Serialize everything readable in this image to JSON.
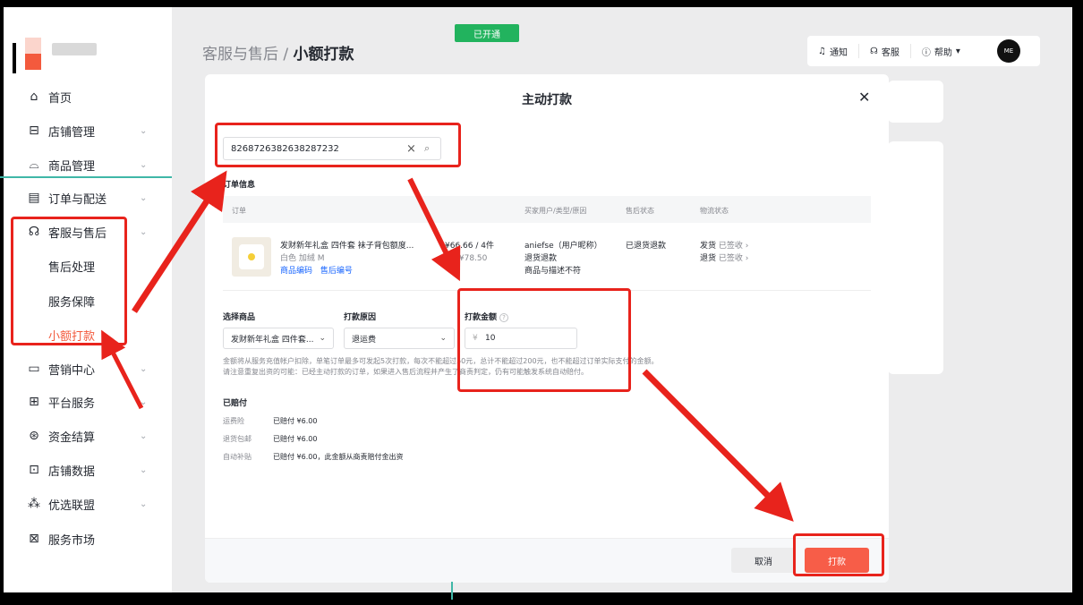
{
  "sidebar": {
    "items": [
      {
        "label": "首页",
        "icon": "home-icon",
        "glyph": "⌂",
        "chevron": false
      },
      {
        "label": "店铺管理",
        "icon": "store-icon",
        "glyph": "⊟",
        "chevron": true
      },
      {
        "label": "商品管理",
        "icon": "bag-icon",
        "glyph": "⌓",
        "chevron": true
      },
      {
        "label": "订单与配送",
        "icon": "order-icon",
        "glyph": "▤",
        "chevron": true
      },
      {
        "label": "客服与售后",
        "icon": "headset-icon",
        "glyph": "☊",
        "chevron": true
      },
      {
        "label": "营销中心",
        "icon": "marketing-icon",
        "glyph": "▭",
        "chevron": true
      },
      {
        "label": "平台服务",
        "icon": "briefcase-icon",
        "glyph": "⊞",
        "chevron": true
      },
      {
        "label": "资金结算",
        "icon": "yuan-icon",
        "glyph": "⊛",
        "chevron": true
      },
      {
        "label": "店铺数据",
        "icon": "chart-icon",
        "glyph": "⊡",
        "chevron": true
      },
      {
        "label": "优选联盟",
        "icon": "alliance-icon",
        "glyph": "⁂",
        "chevron": true
      },
      {
        "label": "服务市场",
        "icon": "market-icon",
        "glyph": "⊠",
        "chevron": false
      }
    ],
    "subitems": [
      "售后处理",
      "服务保障",
      "小额打款"
    ],
    "active_subitem": "小额打款"
  },
  "header": {
    "breadcrumb_parent": "客服与售后",
    "breadcrumb_sep": " / ",
    "breadcrumb_current": "小额打款",
    "badge": "已开通",
    "notify": "通知",
    "service": "客服",
    "help": "帮助",
    "avatar_text": "ME"
  },
  "modal": {
    "title": "主动打款",
    "close_glyph": "✕",
    "search_value": "8268726382638287232",
    "order_info_label": "订单信息",
    "columns": [
      "订单",
      "买家用户/类型/原因",
      "售后状态",
      "物流状态"
    ],
    "order": {
      "product_name": "发财新年礼盒 四件套 袜子背包额度...",
      "spec": "白色 加绒 M",
      "product_code": "商品编码",
      "aftersale_code": "售后编号",
      "price_qty": "¥66.66 / 4件",
      "paid": "款 ¥78.50",
      "buyer": "aniefse（用户昵称）",
      "type": "退货退款",
      "reason": "商品与描述不符",
      "aftersale_status": "已退货退款",
      "ship_label": "发货",
      "ship_status": "已签收 ›",
      "return_label": "退货",
      "return_status": "已签收 ›"
    },
    "select_product_label": "选择商品",
    "select_product_value": "发财新年礼盒 四件套...",
    "reason_label": "打款原因",
    "reason_value": "退运费",
    "amount_label": "打款金额",
    "amount_currency": "¥",
    "amount_value": "10",
    "note_1": "金额将从服务充值帐户扣除，单笔订单最多可发起5次打款，每次不能超过50元，总计不能超过200元，也不能超过订单实际支付的金额。",
    "note_2": "请注意重复出资的可能：已经主动打款的订单，如果进入售后流程并产生了商责判定，仍有可能触发系统自动赔付。",
    "paid_label": "已赔付",
    "paid_rows": [
      {
        "k": "运费险",
        "v": "已赔付 ¥6.00"
      },
      {
        "k": "退货包邮",
        "v": "已赔付 ¥6.00"
      },
      {
        "k": "自动补贴",
        "v": "已赔付 ¥6.00，此金额从商责赔付金出资"
      }
    ],
    "cancel": "取消",
    "pay": "打款"
  },
  "colors": {
    "accent": "#f35a3d",
    "annotation_red": "#e8231c",
    "badge_green": "#22b35e",
    "link_blue": "#1966ff"
  }
}
